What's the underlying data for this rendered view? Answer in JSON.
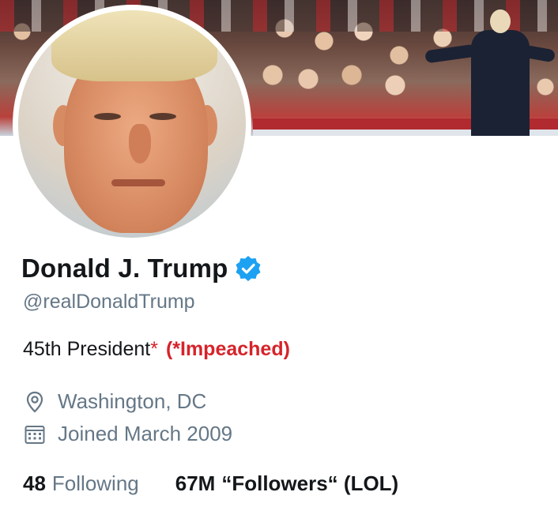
{
  "profile": {
    "display_name": "Donald J. Trump",
    "handle": "@realDonaldTrump",
    "verified": true,
    "bio": {
      "text": "45th President",
      "asterisk": "*",
      "note": "(*Impeached)"
    },
    "location": "Washington, DC",
    "joined": "Joined March 2009",
    "following_count": "48",
    "following_label": "Following",
    "followers_count": "67M",
    "followers_label": "“Followers“ (LOL)"
  },
  "icons": {
    "verified": "verified-badge-icon",
    "location": "location-pin-icon",
    "joined": "calendar-icon"
  },
  "colors": {
    "verified_blue": "#1da1f2",
    "secondary_text": "#657786",
    "primary_text": "#14171a",
    "highlight_red": "#d6232a"
  }
}
